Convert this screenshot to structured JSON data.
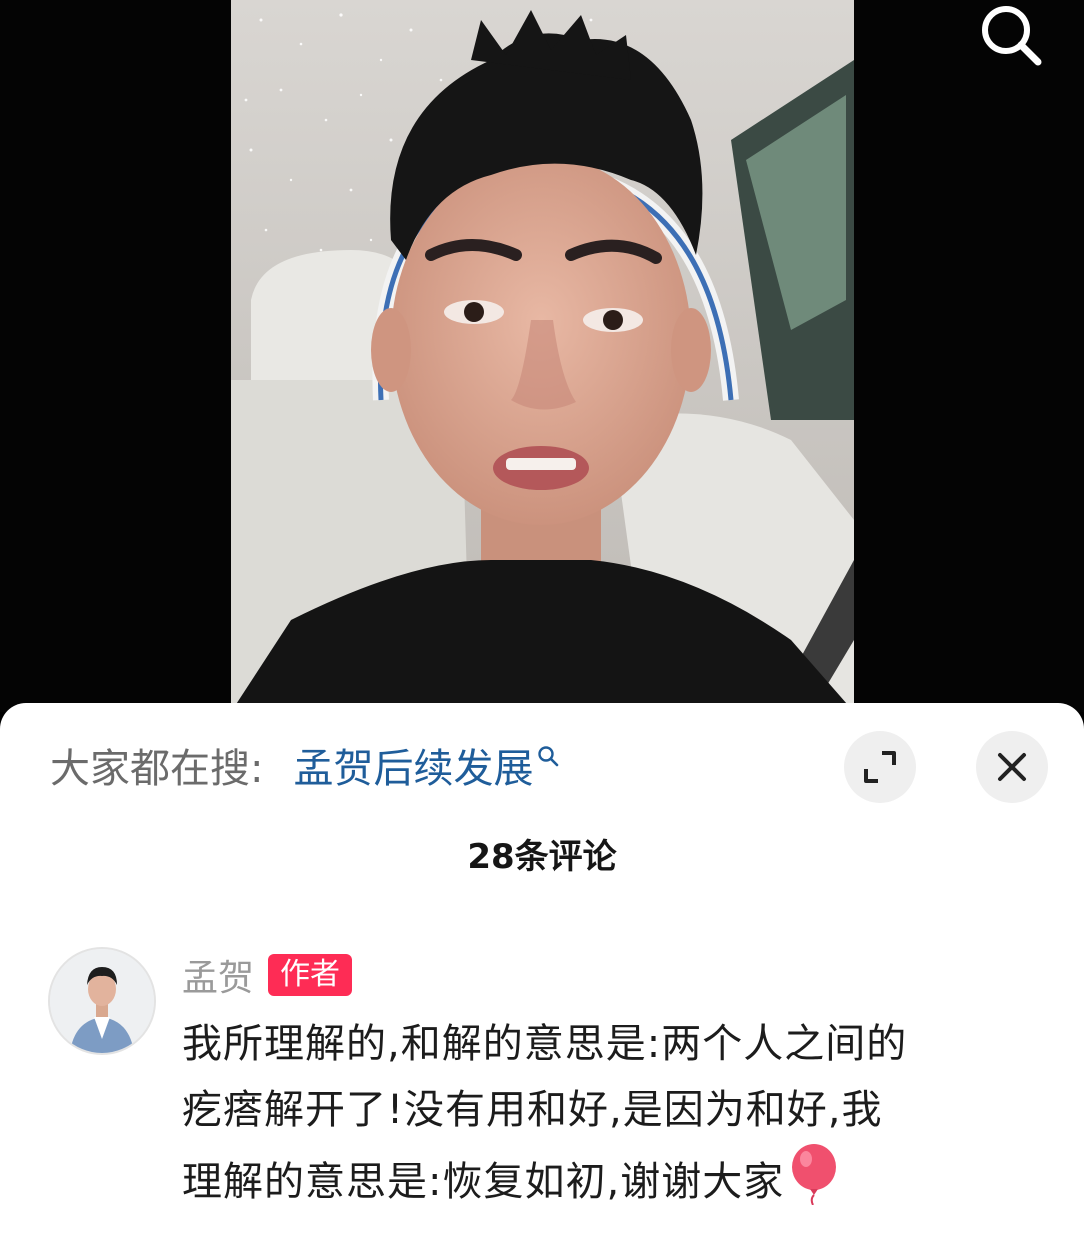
{
  "video": {
    "description_icon": "search-icon"
  },
  "sheet": {
    "trending_prefix": "大家都在搜:",
    "trending_query": "孟贺后续发展",
    "comment_count_label": "28条评论"
  },
  "comment": {
    "username": "孟贺",
    "badge": "作者",
    "line1": "我所理解的,和解的意思是:两个人之间的",
    "line2": "疙瘩解开了!没有用和好,是因为和好,我",
    "line3": "理解的意思是:恢复如初,谢谢大家",
    "emoji": "balloon-icon"
  },
  "colors": {
    "accent_red": "#fe2c55",
    "link_blue": "#1f5d9a",
    "sheet_bg": "#ffffff",
    "video_bg": "#040404"
  }
}
